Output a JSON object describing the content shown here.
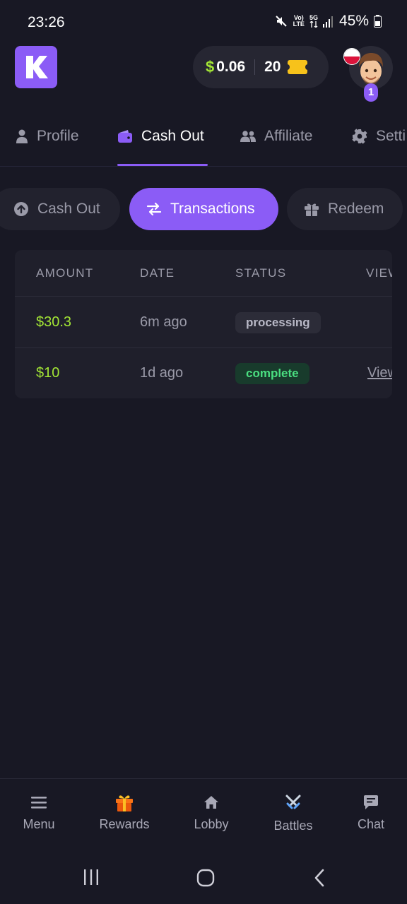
{
  "status_bar": {
    "time": "23:26",
    "network_top": "Vo)",
    "network_bottom": "LTE",
    "gen": "5G",
    "battery": "45%"
  },
  "header": {
    "logo_letter": "K",
    "balance_symbol": "$",
    "balance": "0.06",
    "tickets": "20",
    "level": "1",
    "brand_color": "#8b5cf6"
  },
  "tabs": [
    {
      "label": "Profile",
      "icon": "user-icon"
    },
    {
      "label": "Cash Out",
      "icon": "wallet-icon",
      "active": true
    },
    {
      "label": "Affiliate",
      "icon": "users-icon"
    },
    {
      "label": "Setti",
      "icon": "gear-icon"
    }
  ],
  "subtabs": [
    {
      "label": "Cash Out",
      "icon": "arrow-up-circle-icon"
    },
    {
      "label": "Transactions",
      "icon": "swap-arrows-icon",
      "active": true
    },
    {
      "label": "Redeem",
      "icon": "gift-icon"
    }
  ],
  "table": {
    "headers": [
      "AMOUNT",
      "DATE",
      "STATUS",
      "VIEW"
    ],
    "rows": [
      {
        "amount": "$30.3",
        "date": "6m ago",
        "status": "processing",
        "view": ""
      },
      {
        "amount": "$10",
        "date": "1d ago",
        "status": "complete",
        "view": "View"
      }
    ]
  },
  "bottom_nav": [
    {
      "label": "Menu",
      "icon": "menu-icon"
    },
    {
      "label": "Rewards",
      "icon": "gift-icon"
    },
    {
      "label": "Lobby",
      "icon": "home-icon"
    },
    {
      "label": "Battles",
      "icon": "crossed-swords-icon"
    },
    {
      "label": "Chat",
      "icon": "chat-icon"
    }
  ]
}
